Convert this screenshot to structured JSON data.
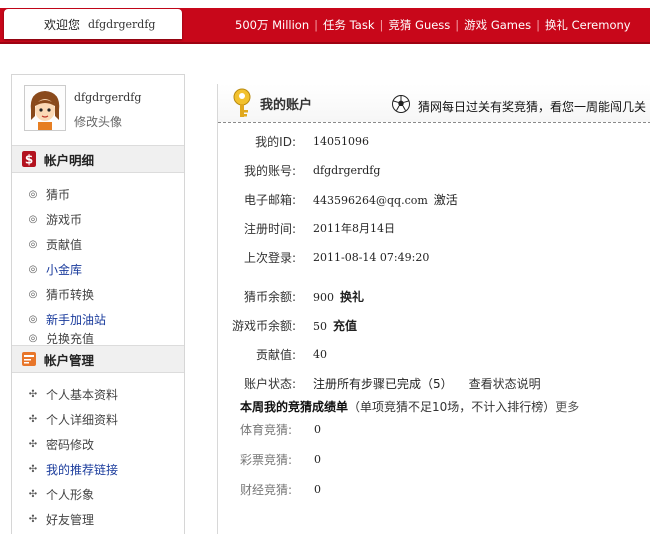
{
  "topbar": {
    "welcome": "欢迎您",
    "username": "dfgdrgerdfg",
    "nav": [
      {
        "label": "500万 Million"
      },
      {
        "label": "任务 Task"
      },
      {
        "label": "竞猜 Guess"
      },
      {
        "label": "游戏 Games"
      },
      {
        "label": "换礼 Ceremony"
      }
    ]
  },
  "sidebar": {
    "profile": {
      "name": "dfgdrgerdfg",
      "edit_avatar": "修改头像"
    },
    "account_detail": {
      "title": "帐户明细",
      "items": [
        {
          "label": "猜币"
        },
        {
          "label": "游戏币"
        },
        {
          "label": "贡献值"
        },
        {
          "label": "小金库"
        },
        {
          "label": "猜币转换"
        },
        {
          "label": "新手加油站"
        },
        {
          "label": "兑换充值"
        }
      ]
    },
    "account_manage": {
      "title": "帐户管理",
      "items": [
        {
          "label": "个人基本资料"
        },
        {
          "label": "个人详细资料"
        },
        {
          "label": "密码修改"
        },
        {
          "label": "我的推荐链接"
        },
        {
          "label": "个人形象"
        },
        {
          "label": "好友管理"
        }
      ]
    }
  },
  "main": {
    "title": "我的账户",
    "notice": "猜网每日过关有奖竞猜，看您一周能闯几关",
    "fields": {
      "id": {
        "label": "我的ID:",
        "value": "14051096"
      },
      "account": {
        "label": "我的账号:",
        "value": "dfgdrgerdfg"
      },
      "email": {
        "label": "电子邮箱:",
        "value": "443596264@qq.com",
        "action": "激活"
      },
      "reg_time": {
        "label": "注册时间:",
        "value": "2011年8月14日"
      },
      "last_login": {
        "label": "上次登录:",
        "value": "2011-08-14 07:49:20"
      },
      "coin_balance": {
        "label": "猜币余额:",
        "value": "900",
        "action": "换礼"
      },
      "game_coin": {
        "label": "游戏币余额:",
        "value": "50",
        "action": "充值"
      },
      "contribution": {
        "label": "贡献值:",
        "value": "40"
      },
      "status": {
        "label": "账户状态:",
        "value": "注册所有步骤已完成（5）",
        "action": "查看状态说明"
      }
    },
    "weekly": {
      "title": "本周我的竞猜成绩单",
      "note": "（单项竞猜不足10场，不计入排行榜）",
      "more": "更多",
      "rows": [
        {
          "label": "体育竞猜:",
          "value": "0"
        },
        {
          "label": "彩票竞猜:",
          "value": "0"
        },
        {
          "label": "财经竞猜:",
          "value": "0"
        }
      ]
    }
  },
  "colors": {
    "brand_red": "#c8071a",
    "link_blue": "#1a3b9c"
  },
  "icons": [
    "avatar-girl",
    "dollar-icon",
    "card-icon",
    "key-icon",
    "soccer-ball-icon"
  ]
}
